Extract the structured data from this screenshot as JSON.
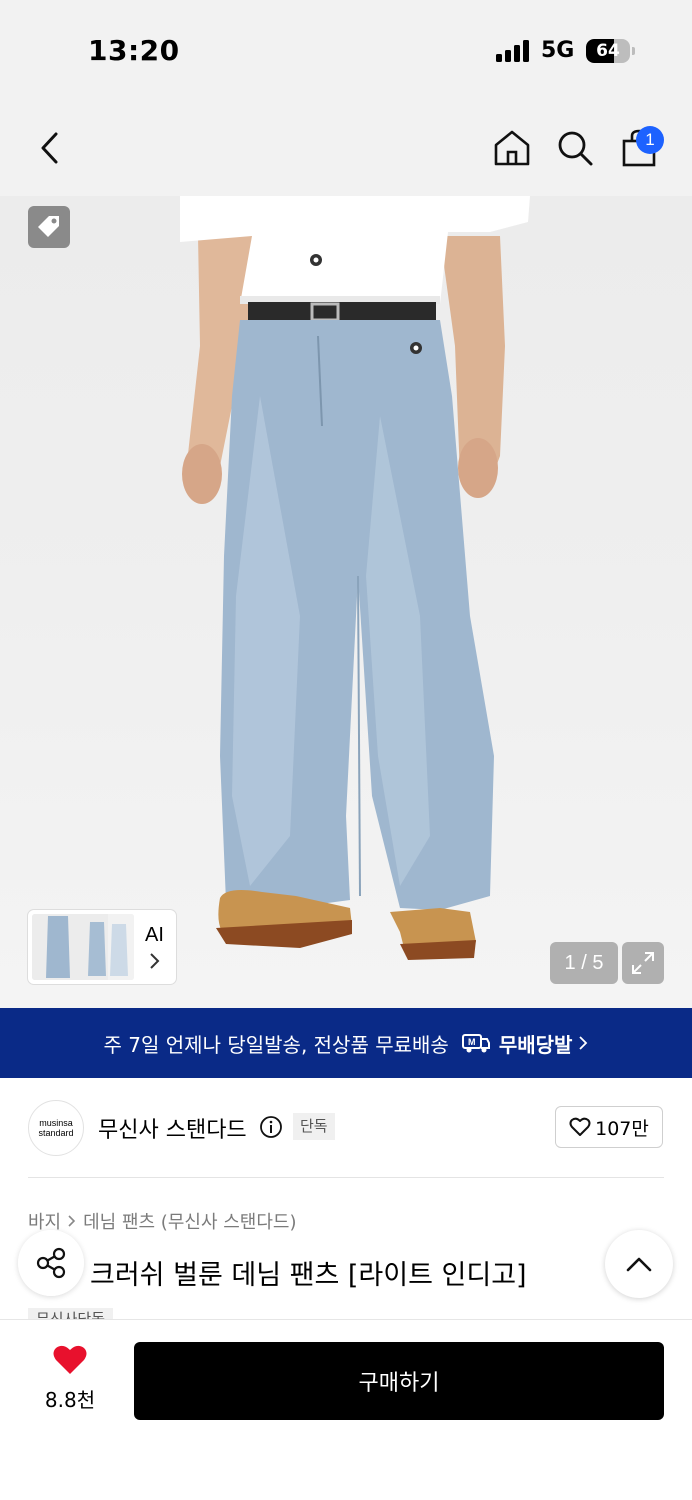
{
  "status_bar": {
    "time": "13:20",
    "network": "5G",
    "battery": "64",
    "battery_level_percent": 64
  },
  "nav": {
    "back_icon": "chevron-left-icon",
    "home_icon": "home-icon",
    "search_icon": "search-icon",
    "cart_icon": "shopping-bag-icon",
    "cart_badge": "1"
  },
  "gallery": {
    "ai_label": "AI",
    "pager": "1 / 5",
    "current_index": 1,
    "total": 5
  },
  "banner": {
    "text": "주 7일 언제나 당일발송, 전상품 무료배송",
    "brand": "무배당발",
    "bg_color": "#0a2a87"
  },
  "brand": {
    "logo_line1": "musinsa",
    "logo_line2": "standard",
    "name": "무신사 스탠다드",
    "badge": "단독",
    "likes": "107만"
  },
  "product": {
    "breadcrumb": [
      "바지",
      "데님 팬츠 (무신사 스탠다드)"
    ],
    "title": "와이드 크러쉬 벌룬 데님 팬츠 [라이트 인디고]",
    "title_visible": "크러쉬 벌룬 데님 팬츠 [라이트 인디고]",
    "sub_badge": "무신사단독"
  },
  "bottom_bar": {
    "wish_count": "8.8천",
    "buy_label": "구매하기",
    "heart_color": "#e8112d"
  }
}
